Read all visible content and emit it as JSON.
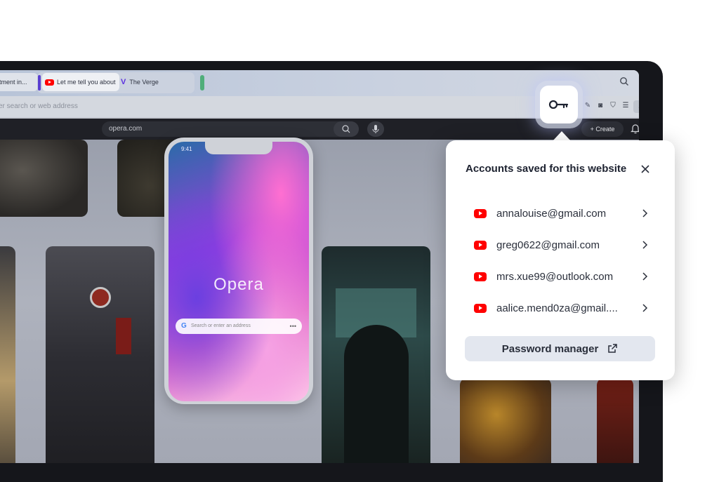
{
  "browser": {
    "tabs": [
      {
        "label": "rtment in..."
      },
      {
        "label": "Let me tell you about",
        "icon": "youtube-icon"
      },
      {
        "label": "The Verge",
        "icon": "verge-icon"
      }
    ],
    "address_placeholder": "er search or web address"
  },
  "page": {
    "url": "opera.com",
    "create_label": "Create"
  },
  "phone": {
    "time": "9:41",
    "brand": "Opera",
    "search_placeholder": "Search or enter an address",
    "google_icon": "G",
    "menu_dots": "•••"
  },
  "popup": {
    "title": "Accounts saved for this website",
    "accounts": [
      {
        "email": "annalouise@gmail.com",
        "icon": "youtube-icon"
      },
      {
        "email": "greg0622@gmail.com",
        "icon": "youtube-icon"
      },
      {
        "email": "mrs.xue99@outlook.com",
        "icon": "youtube-icon"
      },
      {
        "email": "aalice.mend0za@gmail....",
        "icon": "youtube-icon"
      }
    ],
    "password_manager_label": "Password manager"
  },
  "colors": {
    "youtube_red": "#ff0000",
    "popup_button_bg": "#e3e7ef",
    "frame": "#15161b"
  }
}
